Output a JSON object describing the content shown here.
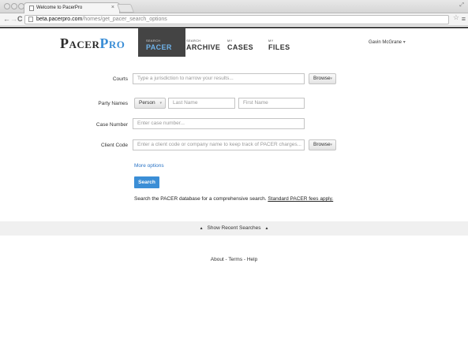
{
  "browser": {
    "tab_title": "Welcome to PacerPro",
    "tab_close": "×",
    "url_host": "beta.pacerpro.com",
    "url_path": "/homes/get_pacer_search_options",
    "back": "←",
    "forward": "→",
    "reload": "C",
    "star": "☆",
    "menu": "≡",
    "resize": "⤢"
  },
  "header": {
    "logo_pacer": "Pacer",
    "logo_pro": "Pro",
    "nav": [
      {
        "small": "SEARCH",
        "big": "PACER",
        "active": true
      },
      {
        "small": "SEARCH",
        "big": "ARCHIVE",
        "active": false
      },
      {
        "small": "MY",
        "big": "CASES",
        "active": false
      },
      {
        "small": "MY",
        "big": "FILES",
        "active": false
      }
    ],
    "user": "Gavin McGrane",
    "user_caret": "▾"
  },
  "form": {
    "courts_label": "Courts",
    "courts_placeholder": "Type a jurisdiction to narrow your results...",
    "browse_label": "Browse",
    "caret": "▾",
    "party_label": "Party Names",
    "party_type": "Person",
    "last_name_placeholder": "Last Name",
    "first_name_placeholder": "First Name",
    "case_number_label": "Case Number",
    "case_number_placeholder": "Enter case number...",
    "client_code_label": "Client Code",
    "client_code_placeholder": "Enter a client code or company name to keep track of PACER charges..."
  },
  "actions": {
    "more_options": "More options",
    "search": "Search",
    "note_text": "Search the PACER database for a comprehensive search. ",
    "note_link": "Standard PACER fees apply."
  },
  "recent": {
    "label": "Show Recent Searches",
    "tri": "▲"
  },
  "footer": {
    "text": "About - Terms - Help"
  }
}
